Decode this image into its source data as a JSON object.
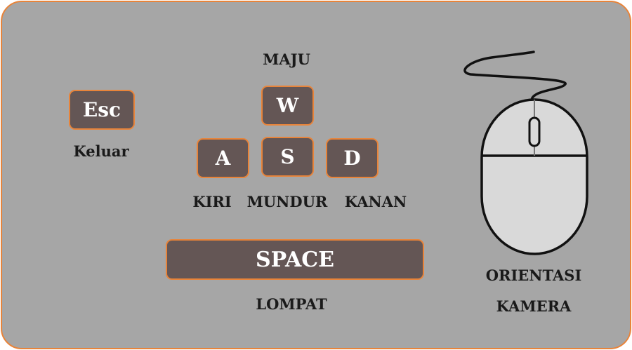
{
  "keys": {
    "esc": "Esc",
    "w": "W",
    "a": "A",
    "s": "S",
    "d": "D",
    "space": "SPACE"
  },
  "labels": {
    "esc": "Keluar",
    "w": "MAJU",
    "a": "KIRI",
    "s": "MUNDUR",
    "d": "KANAN",
    "space": "LOMPAT",
    "mouse_line1": "ORIENTASI",
    "mouse_line2": "KAMERA"
  },
  "colors": {
    "panel_bg": "#a6a6a6",
    "accent": "#e8843a",
    "key_bg": "#645655",
    "mouse_fill": "#d9d9d9"
  },
  "icons": {
    "mouse": "computer-mouse-icon"
  }
}
